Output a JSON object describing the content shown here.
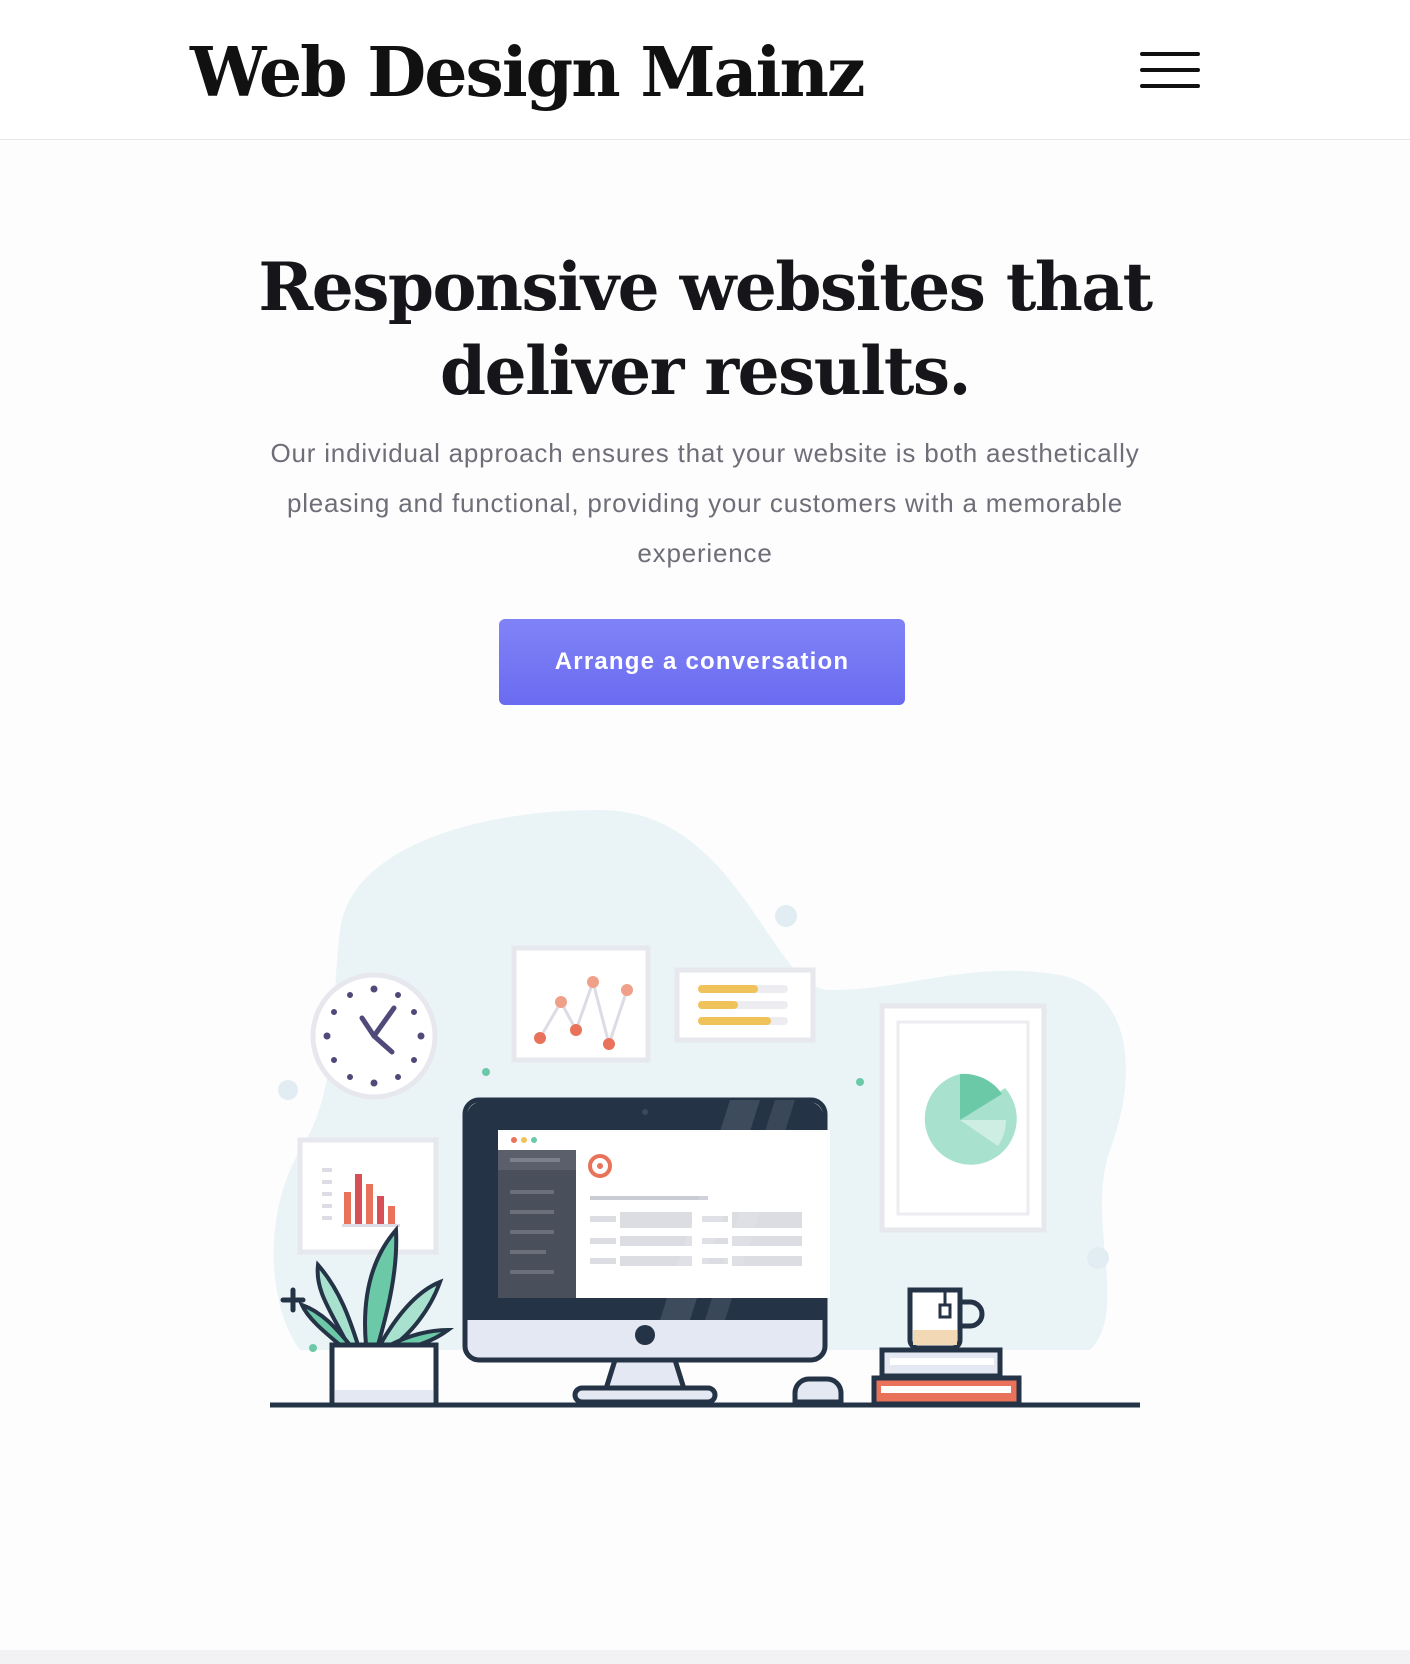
{
  "header": {
    "site_title": "Web Design Mainz",
    "menu_icon": "hamburger-menu-icon"
  },
  "hero": {
    "title_line1": "Responsive websites that",
    "title_line2": "deliver results.",
    "subtitle": "Our individual approach ensures that your website is both aesthetically pleasing and functional, providing your customers with a memorable experience",
    "cta_label": "Arrange a conversation"
  },
  "illustration": {
    "icons": [
      "clock-icon",
      "line-chart-icon",
      "text-lines-icon",
      "pie-chart-icon",
      "bar-chart-icon",
      "desktop-monitor-icon",
      "plant-icon",
      "mouse-icon",
      "coffee-mug-icon",
      "book-stack-icon",
      "plus-icon"
    ]
  },
  "colors": {
    "accent": "#6f71f2",
    "text_dark": "#16161a",
    "text_muted": "#6e6e78",
    "blob": "#eaf4f7",
    "navy": "#243346",
    "teal": "#6cc9a8",
    "coral": "#e8735a",
    "yellow": "#f0c35a"
  }
}
